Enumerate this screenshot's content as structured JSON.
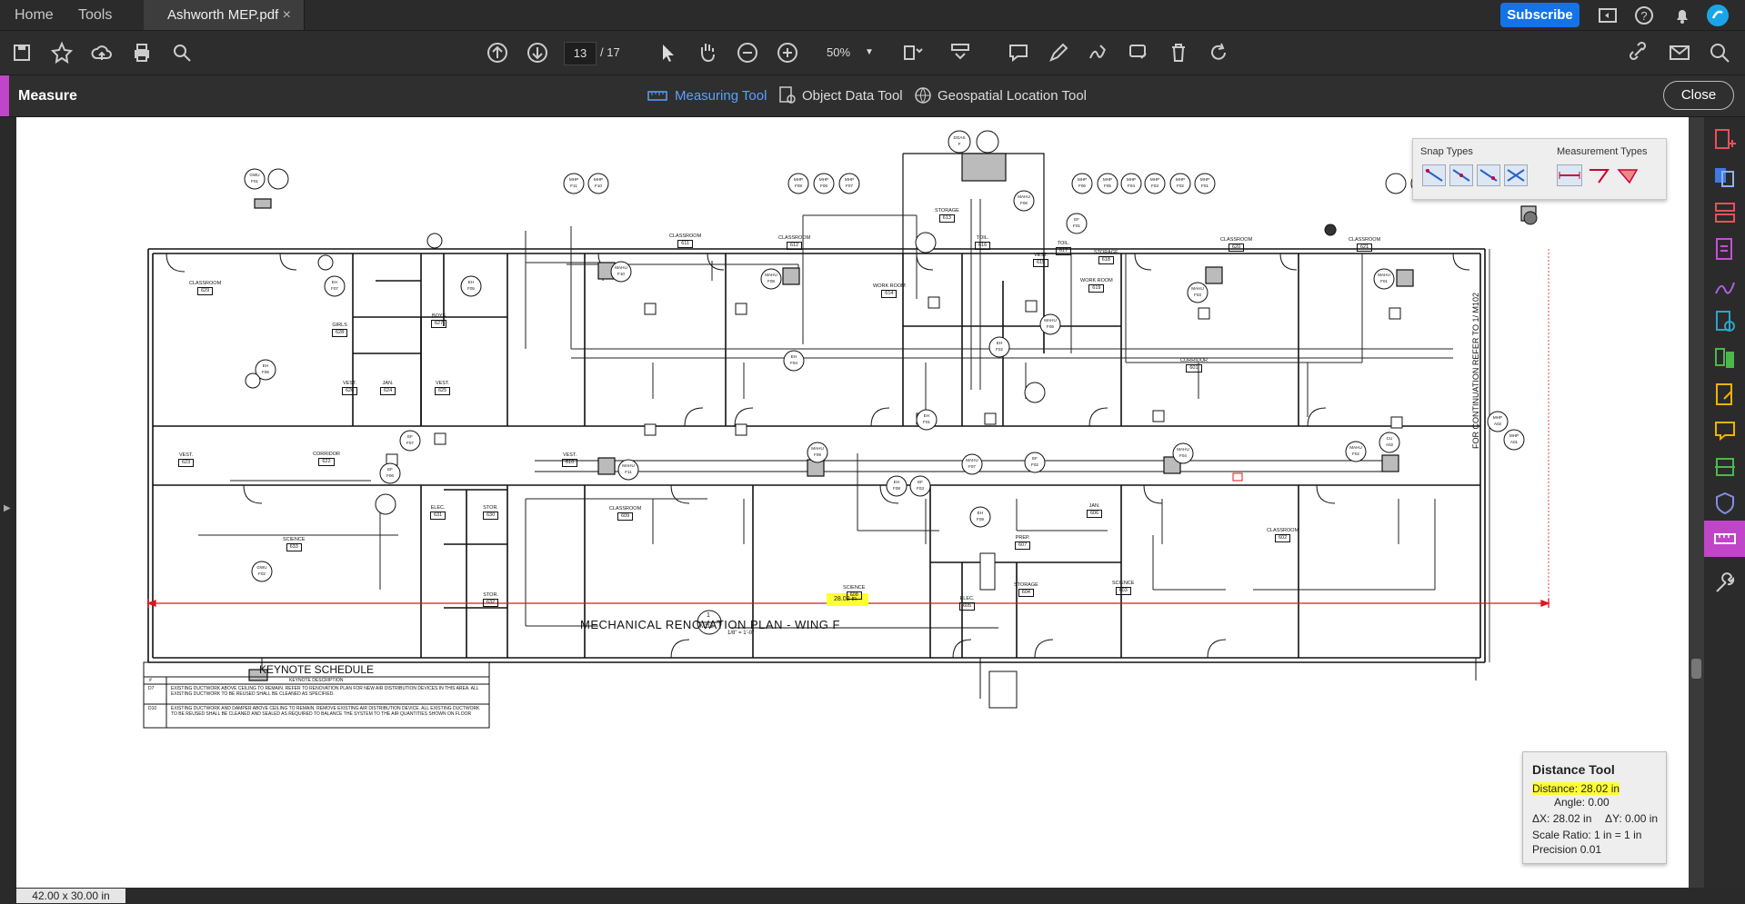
{
  "topbar": {
    "home_label": "Home",
    "tools_label": "Tools",
    "doc_tab_title": "Ashworth MEP.pdf",
    "doc_tab_close": "×",
    "subscribe_label": "Subscribe",
    "icons": [
      "share-screen-icon",
      "help-icon",
      "bell-icon",
      "account-icon"
    ]
  },
  "toolbar": {
    "page_current": "13",
    "page_total": "/ 17",
    "zoom": "50%",
    "icons": [
      "save-icon",
      "bookmark-star-icon",
      "upload-cloud-icon",
      "print-icon",
      "find-icon",
      "page-up-icon",
      "page-down-icon",
      "select-cursor-icon",
      "hand-pan-icon",
      "zoom-out-icon",
      "zoom-in-icon",
      "zoom-dropdown-icon",
      "page-layout-icon",
      "scroll-mode-icon",
      "comment-icon",
      "highlight-pen-icon",
      "sign-icon",
      "stamp-icon",
      "delete-icon",
      "rotate-icon",
      "link-icon",
      "mail-icon",
      "search-icon"
    ]
  },
  "measure_bar": {
    "title": "Measure",
    "tools": [
      {
        "label": "Measuring Tool",
        "active": true
      },
      {
        "label": "Object Data Tool",
        "active": false
      },
      {
        "label": "Geospatial Location Tool",
        "active": false
      }
    ],
    "close_label": "Close"
  },
  "snap_panel": {
    "snap_title": "Snap Types",
    "measurement_title": "Measurement Types"
  },
  "drawing": {
    "title": "MECHANICAL RENOVATION PLAN - WING F",
    "scale": "1/8\" = 1'-0\"",
    "detail_tag_top": "1",
    "detail_tag_bottom": "M112",
    "measure_label": "28.02 in",
    "continuation_note": "FOR CONTINUATION REFER TO    1/ M102",
    "rooms": [
      {
        "name": "CLASSROOM",
        "num": "629"
      },
      {
        "name": "GIRLS",
        "num": "628"
      },
      {
        "name": "BOYS",
        "num": "627"
      },
      {
        "name": "VEST.",
        "num": "626"
      },
      {
        "name": "JAN.",
        "num": "624"
      },
      {
        "name": "VEST.",
        "num": "625"
      },
      {
        "name": "VEST.",
        "num": "623"
      },
      {
        "name": "CORRIDOR",
        "num": "622"
      },
      {
        "name": "SCIENCE",
        "num": "633"
      },
      {
        "name": "ELEC.",
        "num": "631"
      },
      {
        "name": "STOR.",
        "num": "630"
      },
      {
        "name": "STOR.",
        "num": "632"
      },
      {
        "name": "CLASSROOM",
        "num": "611"
      },
      {
        "name": "CLASSROOM",
        "num": "612"
      },
      {
        "name": "VEST.",
        "num": "610"
      },
      {
        "name": "CLASSROOM",
        "num": "609"
      },
      {
        "name": "SCIENCE",
        "num": "608"
      },
      {
        "name": "STORAGE",
        "num": "613"
      },
      {
        "name": "TOIL.",
        "num": "616"
      },
      {
        "name": "VEST.",
        "num": "615"
      },
      {
        "name": "TOIL.",
        "num": "617"
      },
      {
        "name": "STORAGE",
        "num": "618"
      },
      {
        "name": "WORK ROOM",
        "num": "614"
      },
      {
        "name": "WORK ROOM",
        "num": "619"
      },
      {
        "name": "JAN.",
        "num": "606"
      },
      {
        "name": "PREP.",
        "num": "607"
      },
      {
        "name": "STORAGE",
        "num": "604"
      },
      {
        "name": "ELEC.",
        "num": "605"
      },
      {
        "name": "CLASSROOM",
        "num": "620"
      },
      {
        "name": "CLASSROOM",
        "num": "621"
      },
      {
        "name": "CORRIDOR",
        "num": "601"
      },
      {
        "name": "SCIENCE",
        "num": "603"
      },
      {
        "name": "CLASSROOM",
        "num": "602"
      }
    ],
    "equipment_tags": [
      {
        "t": "GWU",
        "b": "F01"
      },
      {
        "t": "MHP",
        "b": "F11"
      },
      {
        "t": "MHP",
        "b": "F10"
      },
      {
        "t": "MHP",
        "b": "F09"
      },
      {
        "t": "MHP",
        "b": "F08"
      },
      {
        "t": "MHP",
        "b": "F07"
      },
      {
        "t": "DOAS",
        "b": "F"
      },
      {
        "t": "MHP",
        "b": "F06"
      },
      {
        "t": "MHP",
        "b": "F05"
      },
      {
        "t": "MHP",
        "b": "F04"
      },
      {
        "t": "MHP",
        "b": "F03"
      },
      {
        "t": "MHP",
        "b": "F02"
      },
      {
        "t": "MHP",
        "b": "F01"
      },
      {
        "t": "EH",
        "b": "F06"
      },
      {
        "t": "EH",
        "b": "F05"
      },
      {
        "t": "EH",
        "b": "F07"
      },
      {
        "t": "MAHU",
        "b": "F10"
      },
      {
        "t": "MAHU",
        "b": "F08"
      },
      {
        "t": "MAHU",
        "b": "F11"
      },
      {
        "t": "MAHU",
        "b": "F09"
      },
      {
        "t": "MAHU",
        "b": "F07"
      },
      {
        "t": "MAHU",
        "b": "F03"
      },
      {
        "t": "MAHU",
        "b": "F01"
      },
      {
        "t": "MAHU",
        "b": "F04"
      },
      {
        "t": "MAHU",
        "b": "F02"
      },
      {
        "t": "MAHU",
        "b": "F05"
      },
      {
        "t": "MAHU",
        "b": "F06"
      },
      {
        "t": "EF",
        "b": "F07"
      },
      {
        "t": "EF",
        "b": "F06"
      },
      {
        "t": "EF",
        "b": "F03"
      },
      {
        "t": "EF",
        "b": "F02"
      },
      {
        "t": "EF",
        "b": "F01"
      },
      {
        "t": "EH",
        "b": "F09"
      },
      {
        "t": "EH",
        "b": "F04"
      },
      {
        "t": "EH",
        "b": "F01"
      },
      {
        "t": "EH",
        "b": "F02"
      },
      {
        "t": "EH",
        "b": "F08"
      },
      {
        "t": "GWU",
        "b": "F02"
      },
      {
        "t": "MHP",
        "b": "A02"
      },
      {
        "t": "MHP",
        "b": "A01"
      },
      {
        "t": "CU",
        "b": "A02"
      }
    ],
    "keynote": {
      "title": "KEYNOTE SCHEDULE",
      "col1": "#",
      "col2": "KEYNOTE DESCRIPTION",
      "rows": [
        {
          "n": "D7",
          "d": "EXISTING DUCTWORK ABOVE CEILING TO REMAIN. REFER TO RENOVATION PLAN FOR NEW AIR DISTRIBUTION DEVICES IN THIS AREA. ALL EXISTING DUCTWORK TO BE REUSED SHALL BE CLEANED AS SPECIFIED."
        },
        {
          "n": "D10",
          "d": "EXISTING DUCTWORK AND DAMPER ABOVE CEILING TO REMAIN. REMOVE EXISTING AIR DISTRIBUTION DEVICE. ALL EXISTING DUCTWORK TO BE REUSED SHALL BE CLEANED AND SEALED AS REQUIRED TO BALANCE THE SYSTEM TO THE AIR QUANTITIES SHOWN ON FLOOR"
        }
      ]
    }
  },
  "distance_panel": {
    "title": "Distance Tool",
    "distance_label": "Distance:",
    "distance_value": "28.02 in",
    "angle": "Angle:  0.00",
    "dx": "ΔX:  28.02 in",
    "dy": "ΔY:  0.00 in",
    "scale_ratio": "Scale Ratio:  1 in = 1 in",
    "precision": "Precision      0.01"
  },
  "status": {
    "page_size": "42.00 x 30.00 in"
  },
  "colors": {
    "accent_blue": "#1473e6",
    "measure_accent": "#c045c8",
    "measure_line": "#e0161c",
    "highlight": "#ffff33"
  }
}
